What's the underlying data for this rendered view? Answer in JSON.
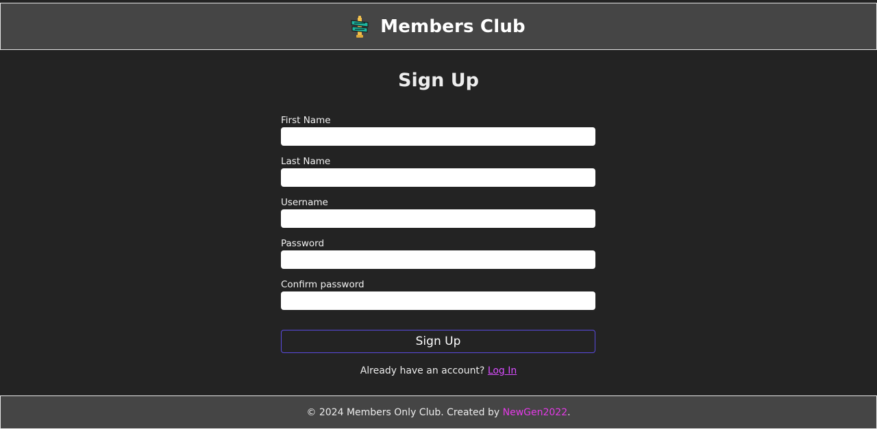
{
  "header": {
    "title": "Members Club",
    "logo_icon": "members-only-sign-icon"
  },
  "form": {
    "title": "Sign Up",
    "fields": [
      {
        "label": "First Name",
        "value": "",
        "placeholder": ""
      },
      {
        "label": "Last Name",
        "value": "",
        "placeholder": ""
      },
      {
        "label": "Username",
        "value": "",
        "placeholder": ""
      },
      {
        "label": "Password",
        "value": "",
        "placeholder": ""
      },
      {
        "label": "Confirm password",
        "value": "",
        "placeholder": ""
      }
    ],
    "submit_label": "Sign Up"
  },
  "login_prompt": {
    "text": "Already have an account?",
    "link_label": "Log In"
  },
  "footer": {
    "copyright": "© 2024 Members Only Club. Created by",
    "author": "NewGen2022",
    "suffix": "."
  },
  "colors": {
    "background": "#232323",
    "bar": "#454545",
    "link": "#d94dff",
    "author": "#e53ae8",
    "button_border": "#5a4be0"
  }
}
